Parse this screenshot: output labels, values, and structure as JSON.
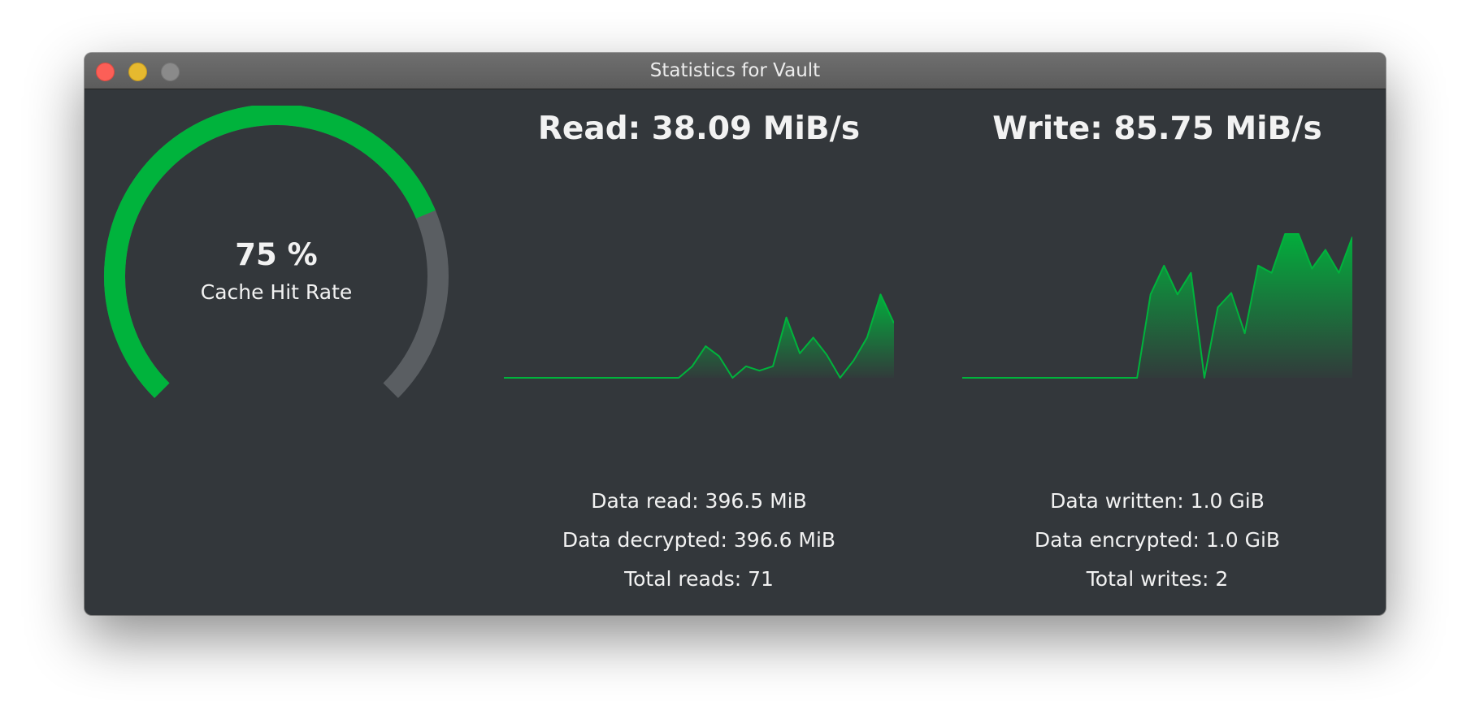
{
  "window": {
    "title": "Statistics for Vault"
  },
  "cache": {
    "value_text": "75 %",
    "label": "Cache Hit Rate",
    "hit_rate_fraction": 0.75
  },
  "read": {
    "title": "Read: 38.09 MiB/s",
    "stats": [
      "Data read: 396.5 MiB",
      "Data decrypted: 396.6 MiB",
      "Total reads: 71"
    ]
  },
  "write": {
    "title": "Write: 85.75 MiB/s",
    "stats": [
      "Data written: 1.0 GiB",
      "Data encrypted: 1.0 GiB",
      "Total writes: 2"
    ]
  },
  "colors": {
    "accent": "#00b33c",
    "track": "#5a5e62",
    "background": "#33373b"
  },
  "chart_data": [
    {
      "type": "area",
      "series": [
        {
          "values": [
            0,
            0,
            0,
            0,
            0,
            0,
            0,
            0,
            0,
            0,
            0,
            0,
            0,
            0,
            0.08,
            0.22,
            0.15,
            0,
            0.08,
            0.05,
            0.08,
            0.42,
            0.17,
            0.28,
            0.16,
            0,
            0.12,
            0.28,
            0.58,
            0.38
          ]
        }
      ],
      "ylim": [
        0,
        1
      ]
    },
    {
      "type": "area",
      "series": [
        {
          "values": [
            0,
            0,
            0,
            0,
            0,
            0,
            0,
            0,
            0,
            0,
            0,
            0,
            0,
            0,
            0.58,
            0.78,
            0.58,
            0.73,
            0,
            0.49,
            0.59,
            0.31,
            0.78,
            0.73,
            1.0,
            1.0,
            0.76,
            0.89,
            0.73,
            0.98
          ]
        }
      ],
      "ylim": [
        0,
        1
      ]
    }
  ]
}
